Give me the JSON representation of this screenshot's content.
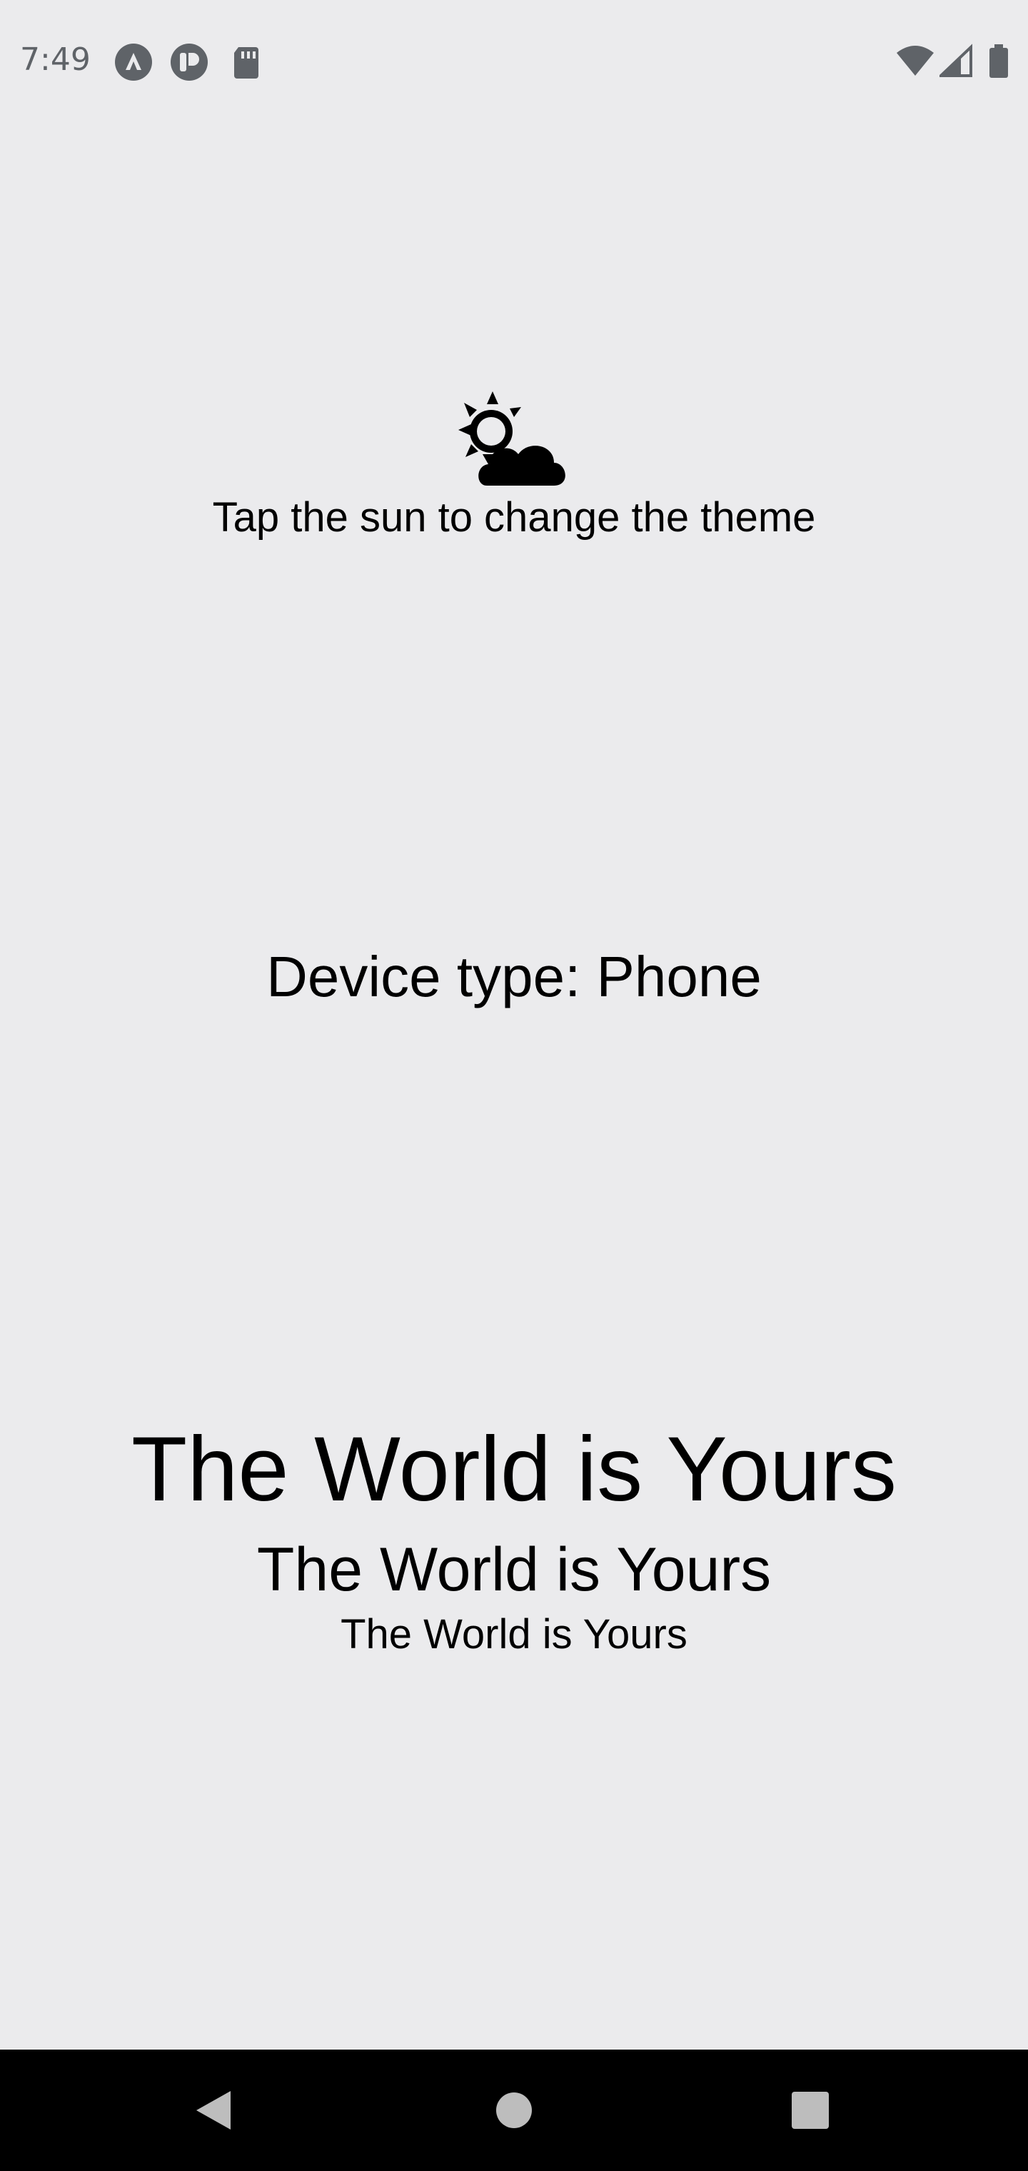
{
  "status_bar": {
    "time": "7:49",
    "left_icons": [
      "app-a-icon",
      "app-p-icon",
      "sd-card-icon"
    ],
    "right_icons": [
      "wifi-icon",
      "cell-signal-icon",
      "battery-icon"
    ]
  },
  "theme": {
    "icon": "sun-cloud-icon",
    "hint": "Tap the sun to change the theme"
  },
  "device": {
    "label": "Device type: Phone"
  },
  "headlines": {
    "large": "The World is Yours",
    "medium": "The World is Yours",
    "small": "The World is Yours"
  },
  "nav_bar": {
    "buttons": [
      "back-icon",
      "home-icon",
      "recents-icon"
    ]
  },
  "colors": {
    "background": "#EBEBED",
    "text": "#000000",
    "status_text": "#5F6368",
    "nav_bar": "#000000"
  }
}
